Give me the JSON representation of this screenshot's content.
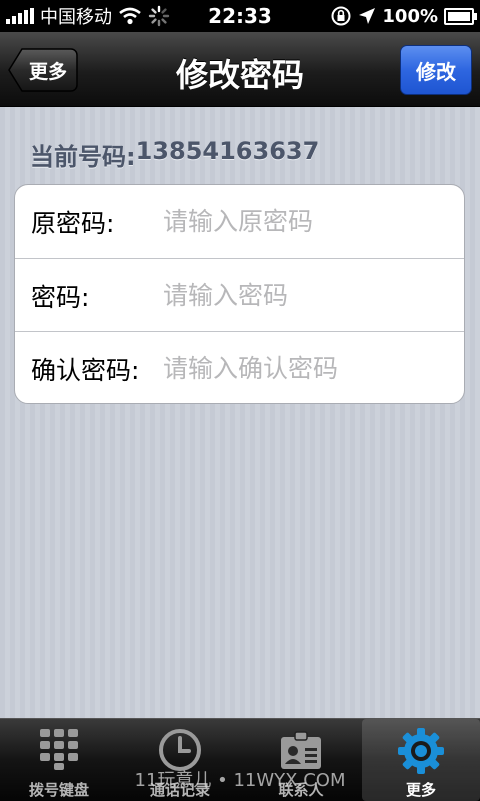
{
  "status_bar": {
    "carrier": "中国移动",
    "time": "22:33",
    "battery": "100%",
    "icons": [
      "signal-bars-icon",
      "wifi-icon",
      "loading-spinner-icon",
      "rotation-lock-icon",
      "location-arrow-icon",
      "battery-icon"
    ]
  },
  "nav": {
    "back_label": "更多",
    "title": "修改密码",
    "action_label": "修改",
    "action_color": "#2e66e0"
  },
  "phone": {
    "label": "当前号码:",
    "number": "13854163637"
  },
  "form": {
    "rows": [
      {
        "label": "原密码:",
        "placeholder": "请输入原密码",
        "value": ""
      },
      {
        "label": "密码:",
        "placeholder": "请输入密码",
        "value": ""
      },
      {
        "label": "确认密码:",
        "placeholder": "请输入确认密码",
        "value": ""
      }
    ]
  },
  "tabbar": {
    "tabs": [
      {
        "label": "拨号键盘",
        "icon": "keypad-icon",
        "active": false
      },
      {
        "label": "通话记录",
        "icon": "clock-icon",
        "active": false
      },
      {
        "label": "联系人",
        "icon": "contact-card-icon",
        "active": false
      },
      {
        "label": "更多",
        "icon": "gear-icon",
        "active": true
      }
    ],
    "active_color": "#1a8fd8"
  },
  "watermark": "11玩意儿 • 11WYX.COM"
}
